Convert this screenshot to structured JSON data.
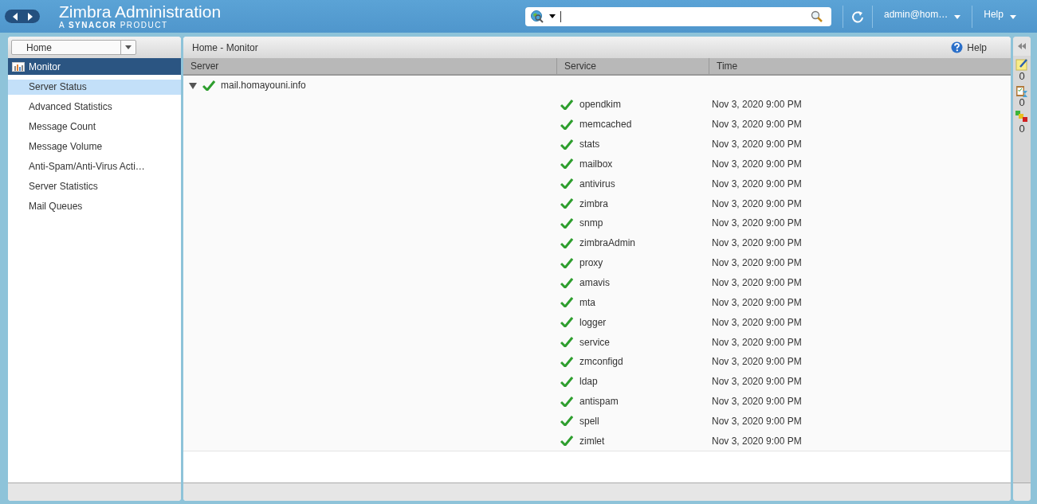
{
  "header": {
    "title": "Zimbra Administration",
    "subtitle_prefix": "A",
    "subtitle_brand": "SYNACOR",
    "subtitle_suffix": "PRODUCT",
    "user": "admin@hom…",
    "help": "Help"
  },
  "sidebar": {
    "breadcrumb": "Home",
    "section": "Monitor",
    "items": [
      {
        "label": "Server Status",
        "selected": true
      },
      {
        "label": "Advanced Statistics",
        "selected": false
      },
      {
        "label": "Message Count",
        "selected": false
      },
      {
        "label": "Message Volume",
        "selected": false
      },
      {
        "label": "Anti-Spam/Anti-Virus Acti…",
        "selected": false
      },
      {
        "label": "Server Statistics",
        "selected": false
      },
      {
        "label": "Mail Queues",
        "selected": false
      }
    ]
  },
  "main": {
    "title": "Home - Monitor",
    "help": "Help",
    "columns": [
      "Server",
      "Service",
      "Time"
    ],
    "server": {
      "name": "mail.homayouni.info",
      "running": true,
      "expanded": true,
      "services": [
        {
          "name": "opendkim",
          "running": true,
          "time": "Nov 3, 2020 9:00 PM"
        },
        {
          "name": "memcached",
          "running": true,
          "time": "Nov 3, 2020 9:00 PM"
        },
        {
          "name": "stats",
          "running": true,
          "time": "Nov 3, 2020 9:00 PM"
        },
        {
          "name": "mailbox",
          "running": true,
          "time": "Nov 3, 2020 9:00 PM"
        },
        {
          "name": "antivirus",
          "running": true,
          "time": "Nov 3, 2020 9:00 PM"
        },
        {
          "name": "zimbra",
          "running": true,
          "time": "Nov 3, 2020 9:00 PM"
        },
        {
          "name": "snmp",
          "running": true,
          "time": "Nov 3, 2020 9:00 PM"
        },
        {
          "name": "zimbraAdmin",
          "running": true,
          "time": "Nov 3, 2020 9:00 PM"
        },
        {
          "name": "proxy",
          "running": true,
          "time": "Nov 3, 2020 9:00 PM"
        },
        {
          "name": "amavis",
          "running": true,
          "time": "Nov 3, 2020 9:00 PM"
        },
        {
          "name": "mta",
          "running": true,
          "time": "Nov 3, 2020 9:00 PM"
        },
        {
          "name": "logger",
          "running": true,
          "time": "Nov 3, 2020 9:00 PM"
        },
        {
          "name": "service",
          "running": true,
          "time": "Nov 3, 2020 9:00 PM"
        },
        {
          "name": "zmconfigd",
          "running": true,
          "time": "Nov 3, 2020 9:00 PM"
        },
        {
          "name": "ldap",
          "running": true,
          "time": "Nov 3, 2020 9:00 PM"
        },
        {
          "name": "antispam",
          "running": true,
          "time": "Nov 3, 2020 9:00 PM"
        },
        {
          "name": "spell",
          "running": true,
          "time": "Nov 3, 2020 9:00 PM"
        },
        {
          "name": "zimlet",
          "running": true,
          "time": "Nov 3, 2020 9:00 PM"
        }
      ]
    }
  },
  "right_strip": {
    "counts": [
      {
        "kind": "notes",
        "value": "0"
      },
      {
        "kind": "tasks",
        "value": "0"
      },
      {
        "kind": "alerts",
        "value": "0"
      }
    ]
  }
}
